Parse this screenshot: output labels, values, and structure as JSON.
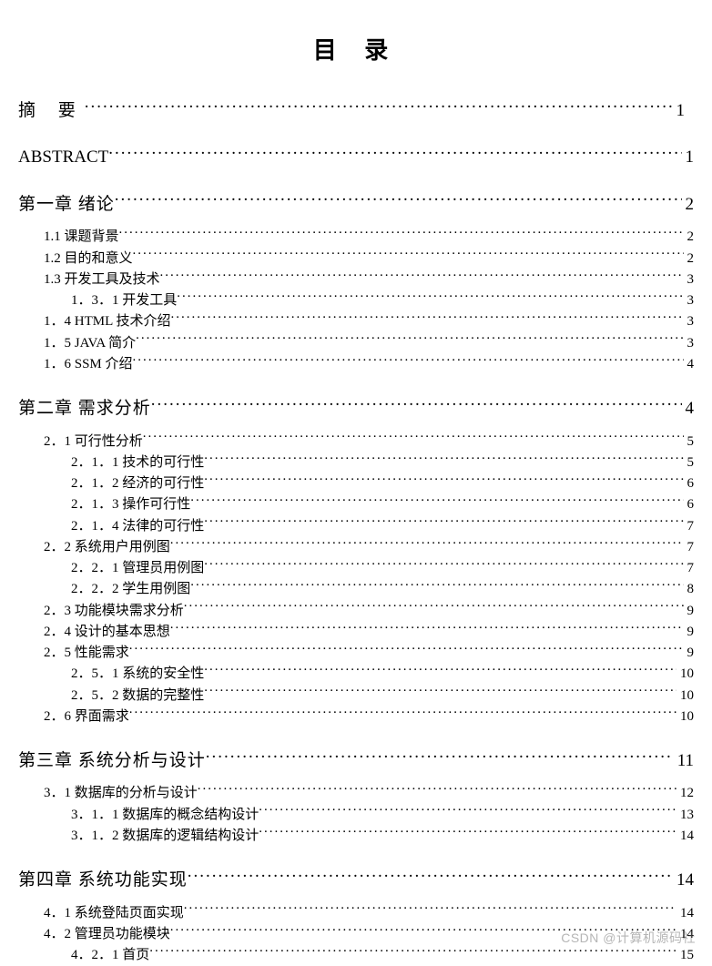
{
  "title": "目 录",
  "watermark": "CSDN @计算机源码社",
  "entries": [
    {
      "level": 0,
      "label": "摘   要",
      "page": "1",
      "cls": "spacer-abstract"
    },
    {
      "level": 0,
      "label": "ABSTRACT",
      "page": "1"
    },
    {
      "level": 0,
      "label": "第一章  绪论",
      "page": "2",
      "cls": "heading"
    },
    {
      "level": 1,
      "label": "1.1 课题背景",
      "page": "2"
    },
    {
      "level": 1,
      "label": "1.2 目的和意义",
      "page": "2"
    },
    {
      "level": 1,
      "label": "1.3 开发工具及技术",
      "page": "3"
    },
    {
      "level": 2,
      "label": "1．3．1 开发工具",
      "page": "3"
    },
    {
      "level": 1,
      "label": "1．4  HTML 技术介绍",
      "page": "3"
    },
    {
      "level": 1,
      "label": "1．5  JAVA 简介",
      "page": "3"
    },
    {
      "level": 1,
      "label": "1．6  SSM 介绍",
      "page": "4"
    },
    {
      "level": 0,
      "label": "第二章  需求分析",
      "page": "4",
      "cls": "heading"
    },
    {
      "level": 1,
      "label": "2．1 可行性分析",
      "page": "5"
    },
    {
      "level": 2,
      "label": "2．1．1 技术的可行性",
      "page": "5"
    },
    {
      "level": 2,
      "label": "2．1．2 经济的可行性",
      "page": "6"
    },
    {
      "level": 2,
      "label": "2．1．3 操作可行性",
      "page": "6"
    },
    {
      "level": 2,
      "label": "2．1．4 法律的可行性",
      "page": "7"
    },
    {
      "level": 1,
      "label": "2．2 系统用户用例图",
      "page": "7"
    },
    {
      "level": 2,
      "label": "2．2．1 管理员用例图",
      "page": "7"
    },
    {
      "level": 2,
      "label": "2．2．2 学生用例图",
      "page": "8"
    },
    {
      "level": 1,
      "label": "2．3 功能模块需求分析",
      "page": "9"
    },
    {
      "level": 1,
      "label": "2．4 设计的基本思想",
      "page": "9"
    },
    {
      "level": 1,
      "label": "2．5 性能需求",
      "page": "9"
    },
    {
      "level": 2,
      "label": "2．5．1 系统的安全性",
      "page": "10"
    },
    {
      "level": 2,
      "label": "2．5．2 数据的完整性",
      "page": "10"
    },
    {
      "level": 1,
      "label": "2．6 界面需求",
      "page": "10"
    },
    {
      "level": 0,
      "label": "第三章   系统分析与设计",
      "page": "11",
      "cls": "heading"
    },
    {
      "level": 1,
      "label": "3．1 数据库的分析与设计",
      "page": "12"
    },
    {
      "level": 2,
      "label": "3．1．1 数据库的概念结构设计",
      "page": "13"
    },
    {
      "level": 2,
      "label": "3．1．2 数据库的逻辑结构设计",
      "page": "14"
    },
    {
      "level": 0,
      "label": "第四章   系统功能实现",
      "page": "14",
      "cls": "heading"
    },
    {
      "level": 1,
      "label": "4．1 系统登陆页面实现",
      "page": "14"
    },
    {
      "level": 1,
      "label": "4．2 管理员功能模块",
      "page": "14"
    },
    {
      "level": 2,
      "label": "4．2．1 首页",
      "page": "15"
    }
  ]
}
